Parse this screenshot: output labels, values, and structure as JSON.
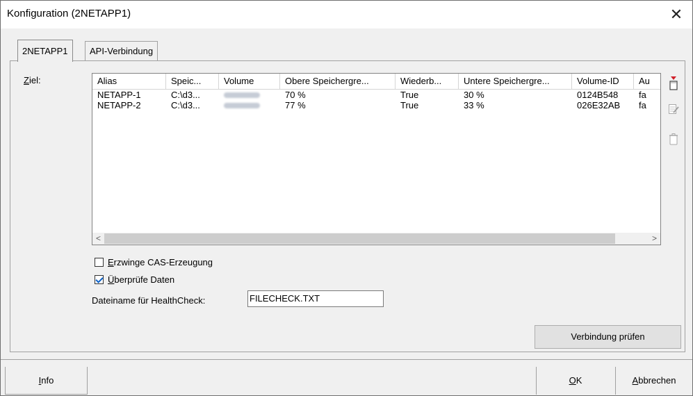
{
  "window": {
    "title": "Konfiguration (2NETAPP1)",
    "close_glyph": "✕"
  },
  "tabs": [
    {
      "label": "2NETAPP1",
      "active": true
    },
    {
      "label": "API-Verbindung",
      "active": false
    }
  ],
  "target": {
    "label_mnemonic": "Z",
    "label_rest": "iel:",
    "columns": [
      "Alias",
      "Speic...",
      "Volume",
      "Obere Speichergre...",
      "Wiederb...",
      "Untere Speichergre...",
      "Volume-ID",
      "Au"
    ],
    "rows": [
      {
        "alias": "NETAPP-1",
        "speicher": "C:\\d3...",
        "volume": "[redacted]",
        "obere": "70 %",
        "wiederb": "True",
        "untere": "30 %",
        "volume_id": "0124B548",
        "au": "fa"
      },
      {
        "alias": "NETAPP-2",
        "speicher": "C:\\d3...",
        "volume": "[redacted]",
        "obere": "77 %",
        "wiederb": "True",
        "untere": "33 %",
        "volume_id": "026E32AB",
        "au": "fa"
      }
    ],
    "scroll_left": "<",
    "scroll_right": ">"
  },
  "side_icons": [
    "add-icon",
    "edit-icon",
    "delete-icon"
  ],
  "options": {
    "force_cas": {
      "mnemonic": "E",
      "rest": "rzwinge CAS-Erzeugung",
      "checked": false
    },
    "verify_data": {
      "mnemonic": "Ü",
      "rest": "berprüfe Daten",
      "checked": true
    }
  },
  "healthcheck": {
    "label": "Dateiname für HealthCheck:",
    "value": "FILECHECK.TXT"
  },
  "buttons": {
    "check_connection": "Verbindung prüfen",
    "info_mnemonic": "I",
    "info_rest": "nfo",
    "ok_mnemonic": "O",
    "ok_rest": "K",
    "cancel_mnemonic": "A",
    "cancel_rest": "bbrechen"
  },
  "colors": {
    "accent_check": "#0a60c8",
    "add_icon_red": "#d0202a"
  }
}
